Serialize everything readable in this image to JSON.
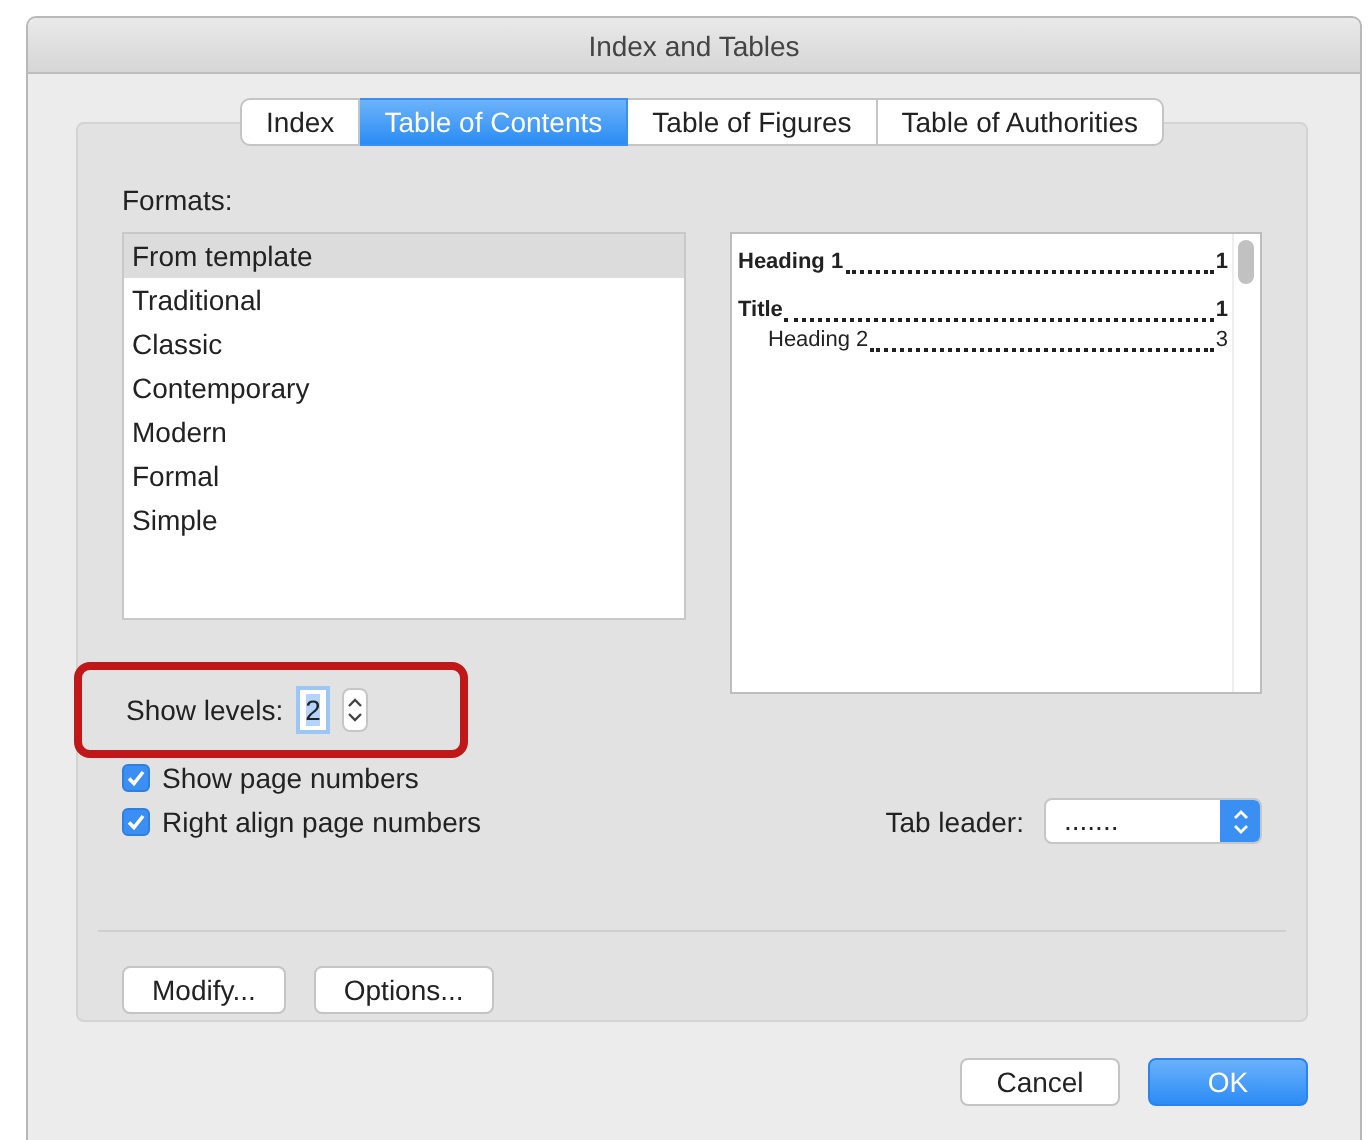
{
  "window": {
    "title": "Index and Tables"
  },
  "tabs": [
    {
      "label": "Index",
      "selected": false
    },
    {
      "label": "Table of Contents",
      "selected": true
    },
    {
      "label": "Table of Figures",
      "selected": false
    },
    {
      "label": "Table of Authorities",
      "selected": false
    }
  ],
  "formats": {
    "label": "Formats:",
    "items": [
      {
        "label": "From template",
        "selected": true
      },
      {
        "label": "Traditional",
        "selected": false
      },
      {
        "label": "Classic",
        "selected": false
      },
      {
        "label": "Contemporary",
        "selected": false
      },
      {
        "label": "Modern",
        "selected": false
      },
      {
        "label": "Formal",
        "selected": false
      },
      {
        "label": "Simple",
        "selected": false
      }
    ]
  },
  "preview": {
    "entries": [
      {
        "label": "Heading 1",
        "page": "1"
      },
      {
        "label": "Title",
        "page": "1",
        "children": [
          {
            "label": "Heading 2",
            "page": "3"
          }
        ]
      }
    ]
  },
  "show_levels": {
    "label": "Show levels:",
    "value": "2",
    "highlighted": true
  },
  "options": [
    {
      "label": "Show page numbers",
      "checked": true
    },
    {
      "label": "Right align page numbers",
      "checked": true
    }
  ],
  "tab_leader": {
    "label": "Tab leader:",
    "value": "......."
  },
  "panel_buttons": [
    "Modify...",
    "Options..."
  ],
  "dialog_buttons": [
    {
      "label": "Cancel",
      "default": false
    },
    {
      "label": "OK",
      "default": true
    }
  ]
}
